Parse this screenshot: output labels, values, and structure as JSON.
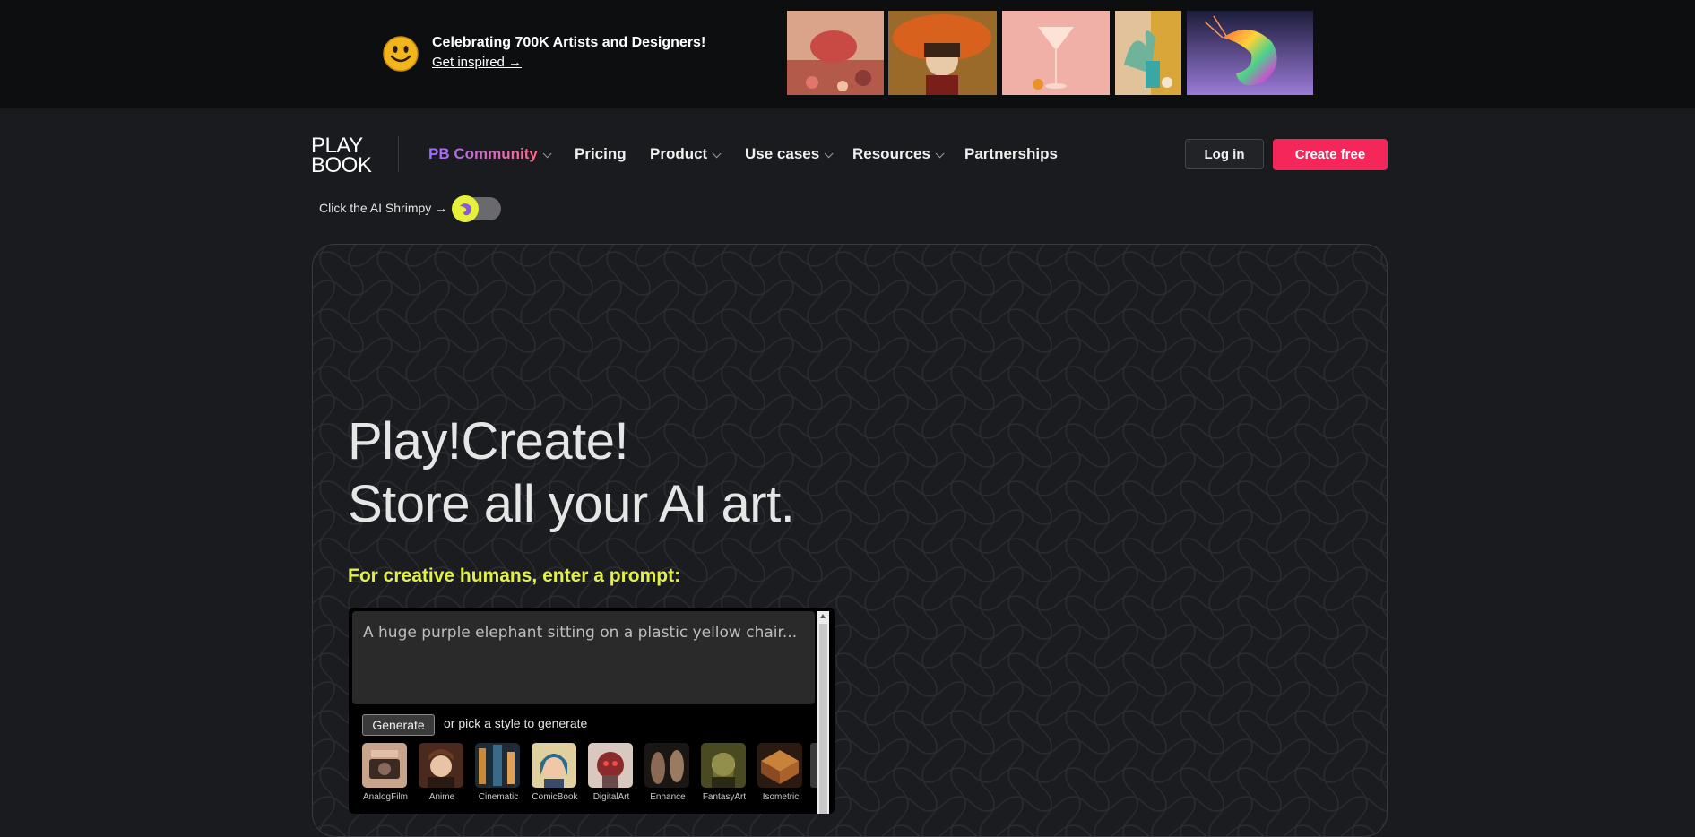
{
  "banner": {
    "title": "Celebrating 700K Artists and Designers!",
    "link": "Get inspired →",
    "thumbnails": [
      "balloon-creature-art",
      "girl-fish-art",
      "cocktail-glass-art",
      "still-life-art",
      "rainbow-shrimp-art"
    ]
  },
  "nav": {
    "logo_line1": "PLAY",
    "logo_line2": "BOOK",
    "items": [
      {
        "label": "PB Community",
        "dropdown": true
      },
      {
        "label": "Pricing",
        "dropdown": false
      },
      {
        "label": "Product",
        "dropdown": true
      },
      {
        "label": "Use cases",
        "dropdown": true
      },
      {
        "label": "Resources",
        "dropdown": true
      },
      {
        "label": "Partnerships",
        "dropdown": false
      }
    ],
    "login": "Log in",
    "create": "Create free"
  },
  "shrimpy": {
    "label": "Click the AI Shrimpy →"
  },
  "hero": {
    "line1": "Play!Create!",
    "line2": "Store all your AI art.",
    "subtitle": "For creative humans, enter a prompt:"
  },
  "prompt": {
    "placeholder": "A huge purple elephant sitting on a plastic yellow chair...",
    "generate": "Generate",
    "hint": "or pick a style to generate",
    "styles": [
      "AnalogFilm",
      "Anime",
      "Cinematic",
      "ComicBook",
      "DigitalArt",
      "Enhance",
      "FantasyArt",
      "Isometric"
    ]
  },
  "colors": {
    "accent_pink": "#f5265a",
    "accent_yellow": "#e3f04a",
    "background": "#1a1b1e"
  }
}
